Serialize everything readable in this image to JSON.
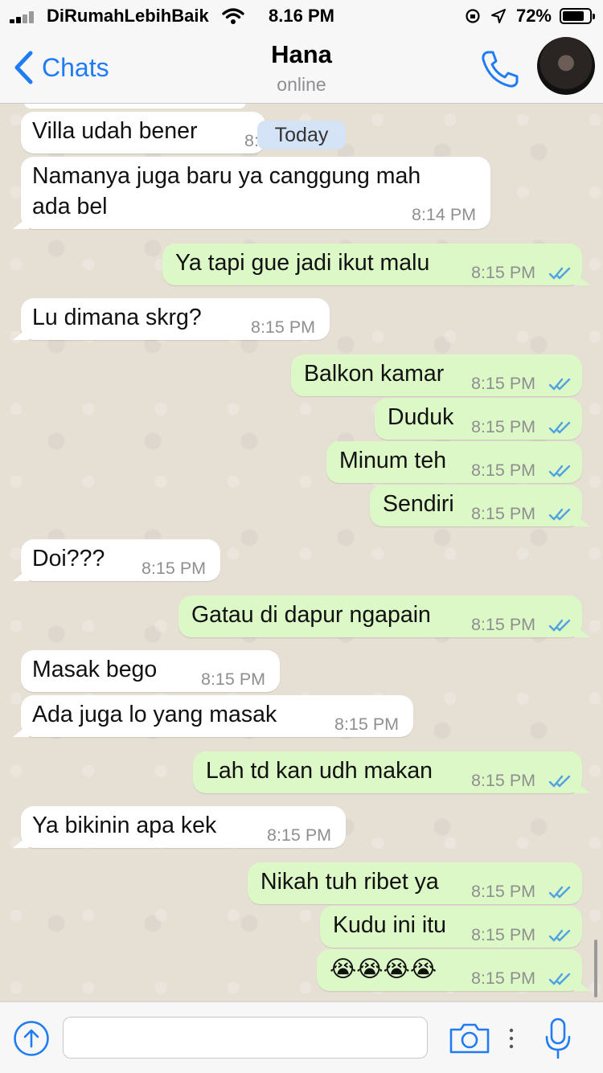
{
  "status_bar": {
    "carrier": "DiRumahLebihBaik",
    "time": "8.16 PM",
    "battery": "72%"
  },
  "header": {
    "back_label": "Chats",
    "contact_name": "Hana",
    "contact_status": "online"
  },
  "date_chip": "Today",
  "messages": [
    {
      "dir": "in",
      "text": "Villa udah bener",
      "time": "8:"
    },
    {
      "dir": "in",
      "text": "Namanya juga baru ya canggung mah",
      "text2": "ada bel",
      "time": "8:14 PM"
    },
    {
      "dir": "out",
      "text": "Ya tapi gue jadi ikut malu",
      "time": "8:15 PM"
    },
    {
      "dir": "in",
      "text": "Lu dimana skrg?",
      "time": "8:15 PM"
    },
    {
      "dir": "out",
      "text": "Balkon kamar",
      "time": "8:15 PM"
    },
    {
      "dir": "out",
      "text": "Duduk",
      "time": "8:15 PM"
    },
    {
      "dir": "out",
      "text": "Minum teh",
      "time": "8:15 PM"
    },
    {
      "dir": "out",
      "text": "Sendiri",
      "time": "8:15 PM"
    },
    {
      "dir": "in",
      "text": "Doi???",
      "time": "8:15 PM"
    },
    {
      "dir": "out",
      "text": "Gatau di dapur ngapain",
      "time": "8:15 PM"
    },
    {
      "dir": "in",
      "text": "Masak bego",
      "time": "8:15 PM"
    },
    {
      "dir": "in",
      "text": "Ada juga lo yang masak",
      "time": "8:15 PM"
    },
    {
      "dir": "out",
      "text": "Lah td kan udh makan",
      "time": "8:15 PM"
    },
    {
      "dir": "in",
      "text": "Ya bikinin apa kek",
      "time": "8:15 PM"
    },
    {
      "dir": "out",
      "text": "Nikah tuh ribet ya",
      "time": "8:15 PM"
    },
    {
      "dir": "out",
      "text": "Kudu ini itu",
      "time": "8:15 PM"
    },
    {
      "dir": "out",
      "text": "😭😭😭😭",
      "time": "8:15 PM"
    }
  ],
  "input": {
    "placeholder": ""
  },
  "colors": {
    "accent": "#1f7cf4",
    "outgoing_bubble": "#dcf8c6",
    "incoming_bubble": "#ffffff",
    "read_ticks": "#4fa3e0"
  },
  "icons": {
    "back": "chevron-left-icon",
    "call": "phone-icon",
    "attach": "arrow-up-circle-icon",
    "camera": "camera-icon",
    "more": "vertical-dots-icon",
    "mic": "microphone-icon",
    "ticks": "double-check-icon"
  }
}
